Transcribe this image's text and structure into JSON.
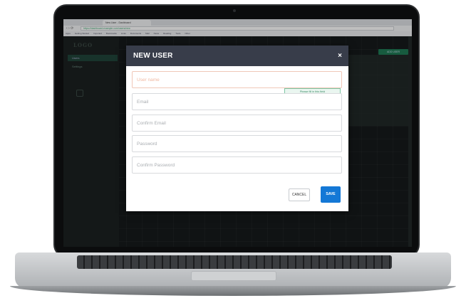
{
  "browser": {
    "tab_title": "New User - Dashboard",
    "url": "https://dashboard.example.com/users/new",
    "bookmarks": [
      "Apps",
      "Getting Started",
      "Imported",
      "Bookmarks",
      "Links",
      "Documents",
      "Mail",
      "News",
      "Reading",
      "Tools",
      "Other"
    ]
  },
  "app": {
    "logo": "LOGO",
    "sidebar_items": [
      "Users",
      "Settings"
    ],
    "header_button": "ADD USER"
  },
  "modal": {
    "title": "NEW USER",
    "close_glyph": "×",
    "fields": {
      "username_placeholder": "User name",
      "email_placeholder": "Email",
      "confirm_email_placeholder": "Confirm Email",
      "password_placeholder": "Password",
      "confirm_password_placeholder": "Confirm Password"
    },
    "tooltip": "Please fill in this field",
    "cancel_label": "CANCEL",
    "save_label": "SAVE"
  },
  "colors": {
    "header": "#383d4a",
    "save_button": "#1478d6",
    "tooltip_border": "#7cc6a3",
    "error_border": "#f0c8b8"
  }
}
